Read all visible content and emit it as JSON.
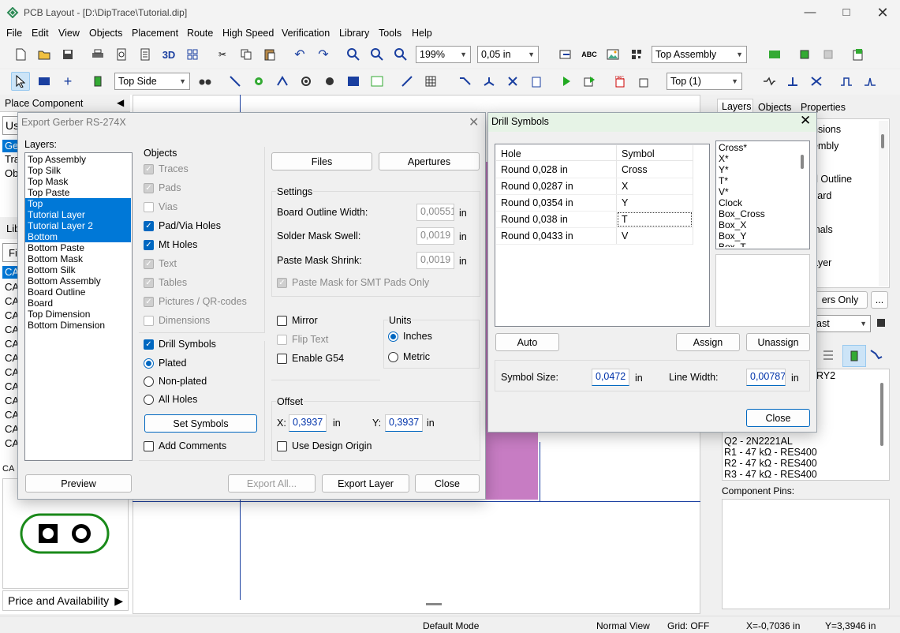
{
  "app": {
    "title": "PCB Layout - [D:\\DipTrace\\Tutorial.dip]"
  },
  "menu": [
    "File",
    "Edit",
    "View",
    "Objects",
    "Placement",
    "Route",
    "High Speed",
    "Verification",
    "Library",
    "Tools",
    "Help"
  ],
  "toolbar": {
    "zoom": "199%",
    "grid": "0,05 in",
    "assembly": "Top Assembly",
    "side": "Top Side",
    "layer": "Top (1)"
  },
  "left": {
    "header": "Place Component",
    "tab_partial": "Us",
    "lib_rows": [
      "Ge",
      "Tra",
      "Ob"
    ],
    "lib_label": "Lib",
    "filter_label": "Fil",
    "cap_items": [
      "CA",
      "CA",
      "CA",
      "CA",
      "CA",
      "CA",
      "CA",
      "CA",
      "CA",
      "CA",
      "CA",
      "CA",
      "CA"
    ],
    "price": "Price and Availability"
  },
  "right": {
    "tabs": [
      "Layers",
      "Objects",
      "Properties"
    ],
    "layer_items": [
      "nsions",
      "embly",
      "",
      "d Outline",
      "yard",
      "",
      "inals",
      "",
      "ayer"
    ],
    "btn_only": "ers Only",
    "btn_more": "...",
    "combo": "ast",
    "comp_first": "RY2",
    "components": [
      "Q2 - 2N2221AL",
      "R1 - 47 kΩ - RES400",
      "R2 - 47 kΩ - RES400",
      "R3 - 47 kΩ - RES400"
    ],
    "pins_label": "Component Pins:"
  },
  "gerber": {
    "title": "Export Gerber RS-274X",
    "layers_label": "Layers:",
    "layers": [
      "Top Assembly",
      "Top Silk",
      "Top Mask",
      "Top Paste",
      "Top",
      "Tutorial Layer",
      "Tutorial Layer 2",
      "Bottom",
      "Bottom Paste",
      "Bottom Mask",
      "Bottom Silk",
      "Bottom Assembly",
      "Board Outline",
      "Board",
      "Top Dimension",
      "Bottom Dimension"
    ],
    "objects_label": "Objects",
    "objects": [
      "Traces",
      "Pads",
      "Vias",
      "Pad/Via Holes",
      "Mt Holes",
      "Text",
      "Tables",
      "Pictures / QR-codes",
      "Dimensions"
    ],
    "drill_symbols": "Drill Symbols",
    "plated": "Plated",
    "non_plated": "Non-plated",
    "all_holes": "All Holes",
    "set_symbols": "Set Symbols",
    "add_comments": "Add Comments",
    "files": "Files",
    "apertures": "Apertures",
    "settings_label": "Settings",
    "board_outline_width": "Board Outline Width:",
    "bow_value": "0,00551",
    "solder_mask": "Solder Mask Swell:",
    "sm_value": "0,0019",
    "paste_mask": "Paste Mask Shrink:",
    "pm_value": "0,0019",
    "paste_smt": "Paste Mask for SMT Pads Only",
    "unit_in": "in",
    "mirror": "Mirror",
    "flip_text": "Flip Text",
    "enable_g54": "Enable G54",
    "units_label": "Units",
    "inches": "Inches",
    "metric": "Metric",
    "offset_label": "Offset",
    "x_label": "X:",
    "x_value": "0,3937",
    "y_label": "Y:",
    "y_value": "0,3937",
    "use_design_origin": "Use Design Origin",
    "preview": "Preview",
    "export_all": "Export All...",
    "export_layer": "Export Layer",
    "close": "Close"
  },
  "drill": {
    "title": "Drill Symbols",
    "col_hole": "Hole",
    "col_symbol": "Symbol",
    "rows": [
      {
        "hole": "Round 0,028 in",
        "symbol": "Cross"
      },
      {
        "hole": "Round 0,0287 in",
        "symbol": "X"
      },
      {
        "hole": "Round 0,0354 in",
        "symbol": "Y"
      },
      {
        "hole": "Round 0,038 in",
        "symbol": "T"
      },
      {
        "hole": "Round 0,0433 in",
        "symbol": "V"
      }
    ],
    "symbols": [
      "Cross*",
      "X*",
      "Y*",
      "T*",
      "V*",
      "Clock",
      "Box_Cross",
      "Box_X",
      "Box_Y",
      "Box_T"
    ],
    "auto": "Auto",
    "assign": "Assign",
    "unassign": "Unassign",
    "symbol_size_label": "Symbol Size:",
    "symbol_size": "0,0472",
    "line_width_label": "Line Width:",
    "line_width": "0,00787",
    "unit_in": "in",
    "close": "Close"
  },
  "status": {
    "mode": "Default Mode",
    "view": "Normal View",
    "grid": "Grid: OFF",
    "x": "X=-0,7036 in",
    "y": "Y=3,3946 in"
  },
  "colors": {
    "accent": "#0067c0",
    "selection": "#0078d7",
    "board": "#c77cc3",
    "footprint": "#1a8a1a"
  }
}
